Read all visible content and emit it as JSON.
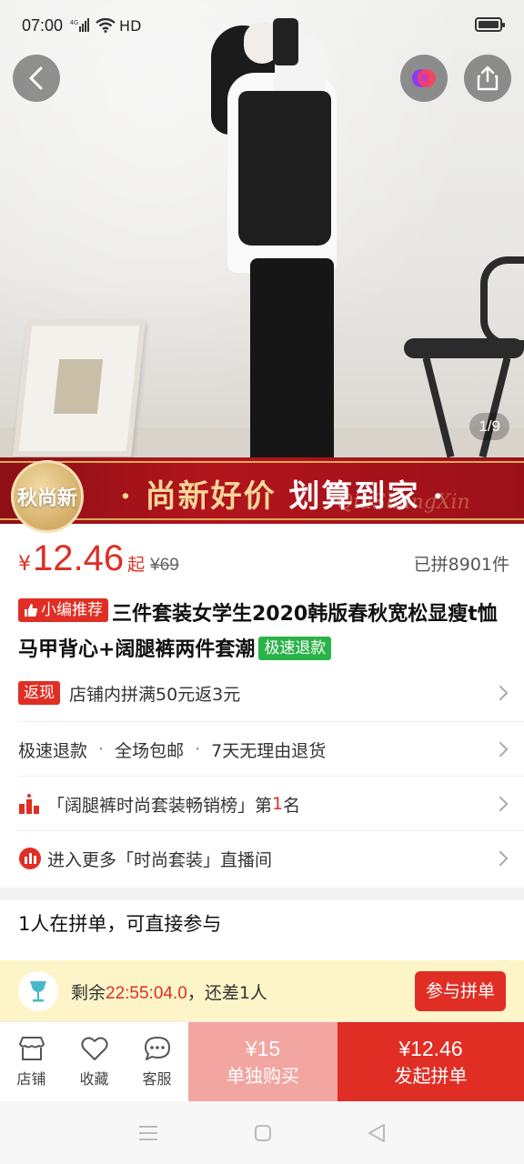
{
  "status_bar": {
    "time": "07:00",
    "network": "4G",
    "hd": "HD",
    "icons": [
      "signal-icon",
      "wifi-icon",
      "battery-icon"
    ]
  },
  "hero": {
    "image_counter": "1/9",
    "icons": [
      "back-icon",
      "share-icon",
      "brand-icon"
    ]
  },
  "banner": {
    "badge": "秋尚新",
    "text_gold": "· 尚新好价",
    "text_white": "划算到家 ·",
    "watermark": "QiuShangXin"
  },
  "price": {
    "currency": "¥",
    "amount": "12.46",
    "suffix": "起",
    "original": "¥69",
    "sold": "已拼8901件"
  },
  "title": {
    "tag": "小编推荐",
    "text": "三件套装女学生2020韩版春秋宽松显瘦t恤马甲背心+阔腿裤两件套潮",
    "refund_tag": "极速退款"
  },
  "cashback": {
    "tag": "返现",
    "text": "店铺内拼满50元返3元"
  },
  "services": [
    "极速退款",
    "全场包邮",
    "7天无理由退货"
  ],
  "ranking": {
    "prefix": "「阔腿裤时尚套装畅销榜」第",
    "rank": "1",
    "suffix": "名"
  },
  "live": {
    "text": "进入更多「时尚套装」直播间"
  },
  "group": {
    "title": "1人在拼单，可直接参与",
    "remaining_label": "剩余",
    "countdown": "22:55:04.0",
    "need_text": "，还差1人",
    "join_button": "参与拼单"
  },
  "action_bar": {
    "shop": "店铺",
    "favorite": "收藏",
    "service": "客服",
    "alone_price": "¥15",
    "alone_label": "单独购买",
    "group_price": "¥12.46",
    "group_label": "发起拼单"
  },
  "colors": {
    "accent": "#e02e24",
    "green": "#2bb34a",
    "group_bar": "#fdf5c7",
    "alone_button": "#f2a5a1"
  }
}
